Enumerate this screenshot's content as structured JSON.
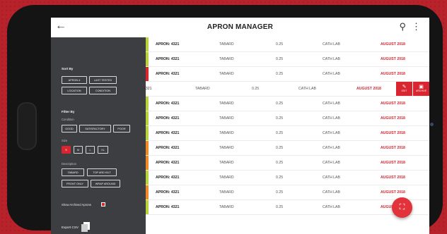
{
  "app": {
    "title": "APRON MANAGER"
  },
  "icons": {
    "back": "back-arrow-icon",
    "search": "search-icon",
    "more": "more-vert-icon",
    "edit": "edit-icon",
    "archive": "archive-icon",
    "scan": "scan-icon",
    "export": "export-csv-icon"
  },
  "colors": {
    "accent": "#d9252f",
    "sidebar": "#3c3e42"
  },
  "sidebar": {
    "sort_by": "Sort By",
    "sort_options": [
      "APRON #",
      "LAST TESTED",
      "LOCATION",
      "CONDITION"
    ],
    "filter_by": "Filter By",
    "condition_label": "Condition",
    "condition_options": [
      "GOOD",
      "SATISFACTORY",
      "POOR"
    ],
    "size_label": "Size",
    "size_options": [
      "S",
      "M",
      "L",
      "XL"
    ],
    "size_selected": "S",
    "description_label": "Description",
    "description_options": [
      "TABARD",
      "TOP ARD KILT",
      "FRONT ONLY",
      "WRAP AROUND"
    ],
    "show_archived": "Show Archived Aprons",
    "show_archived_checked": true,
    "export": "Export CSV"
  },
  "rows": [
    {
      "apron": "APRON: 4321",
      "type": "TABARD",
      "value": "0.25",
      "location": "CATH LAB",
      "date": "AUGUST 2018",
      "status_color": "#b8d43a"
    },
    {
      "apron": "APRON: 4321",
      "type": "TABARD",
      "value": "0.25",
      "location": "CATH LAB",
      "date": "AUGUST 2018",
      "status_color": "#b8d43a"
    },
    {
      "apron": "APRON: 4321",
      "type": "TABARD",
      "value": "0.25",
      "location": "CATH LAB",
      "date": "AUGUST 2018",
      "status_color": "#d9252f"
    },
    {
      "apron": "4321",
      "type": "TABARD",
      "value": "0.25",
      "location": "CATH LAB",
      "date": "AUGUST 2018",
      "status_color": "",
      "actions": [
        "EDIT",
        "ARCHIVE"
      ]
    },
    {
      "apron": "APRON: 4321",
      "type": "TABARD",
      "value": "0.25",
      "location": "CATH LAB",
      "date": "AUGUST 2018",
      "status_color": "#b8d43a"
    },
    {
      "apron": "APRON: 4321",
      "type": "TABARD",
      "value": "0.25",
      "location": "CATH LAB",
      "date": "AUGUST 2018",
      "status_color": "#b8d43a"
    },
    {
      "apron": "APRON: 4321",
      "type": "TABARD",
      "value": "0.25",
      "location": "CATH LAB",
      "date": "AUGUST 2018",
      "status_color": "#b8d43a"
    },
    {
      "apron": "APRON: 4321",
      "type": "TABARD",
      "value": "0.25",
      "location": "CATH LAB",
      "date": "AUGUST 2018",
      "status_color": "#f08a24"
    },
    {
      "apron": "APRON: 4321",
      "type": "TABARD",
      "value": "0.25",
      "location": "CATH LAB",
      "date": "AUGUST 2018",
      "status_color": "#f08a24"
    },
    {
      "apron": "APRON: 4321",
      "type": "TABARD",
      "value": "0.25",
      "location": "CATH LAB",
      "date": "AUGUST 2018",
      "status_color": "#b8d43a"
    },
    {
      "apron": "APRON: 4321",
      "type": "TABARD",
      "value": "0.25",
      "location": "CATH LAB",
      "date": "AUGUST 2018",
      "status_color": "#f08a24"
    },
    {
      "apron": "APRON: 4321",
      "type": "TABARD",
      "value": "0.25",
      "location": "CATH LAB",
      "date": "AUGUST 2018",
      "status_color": "#b8d43a"
    }
  ]
}
